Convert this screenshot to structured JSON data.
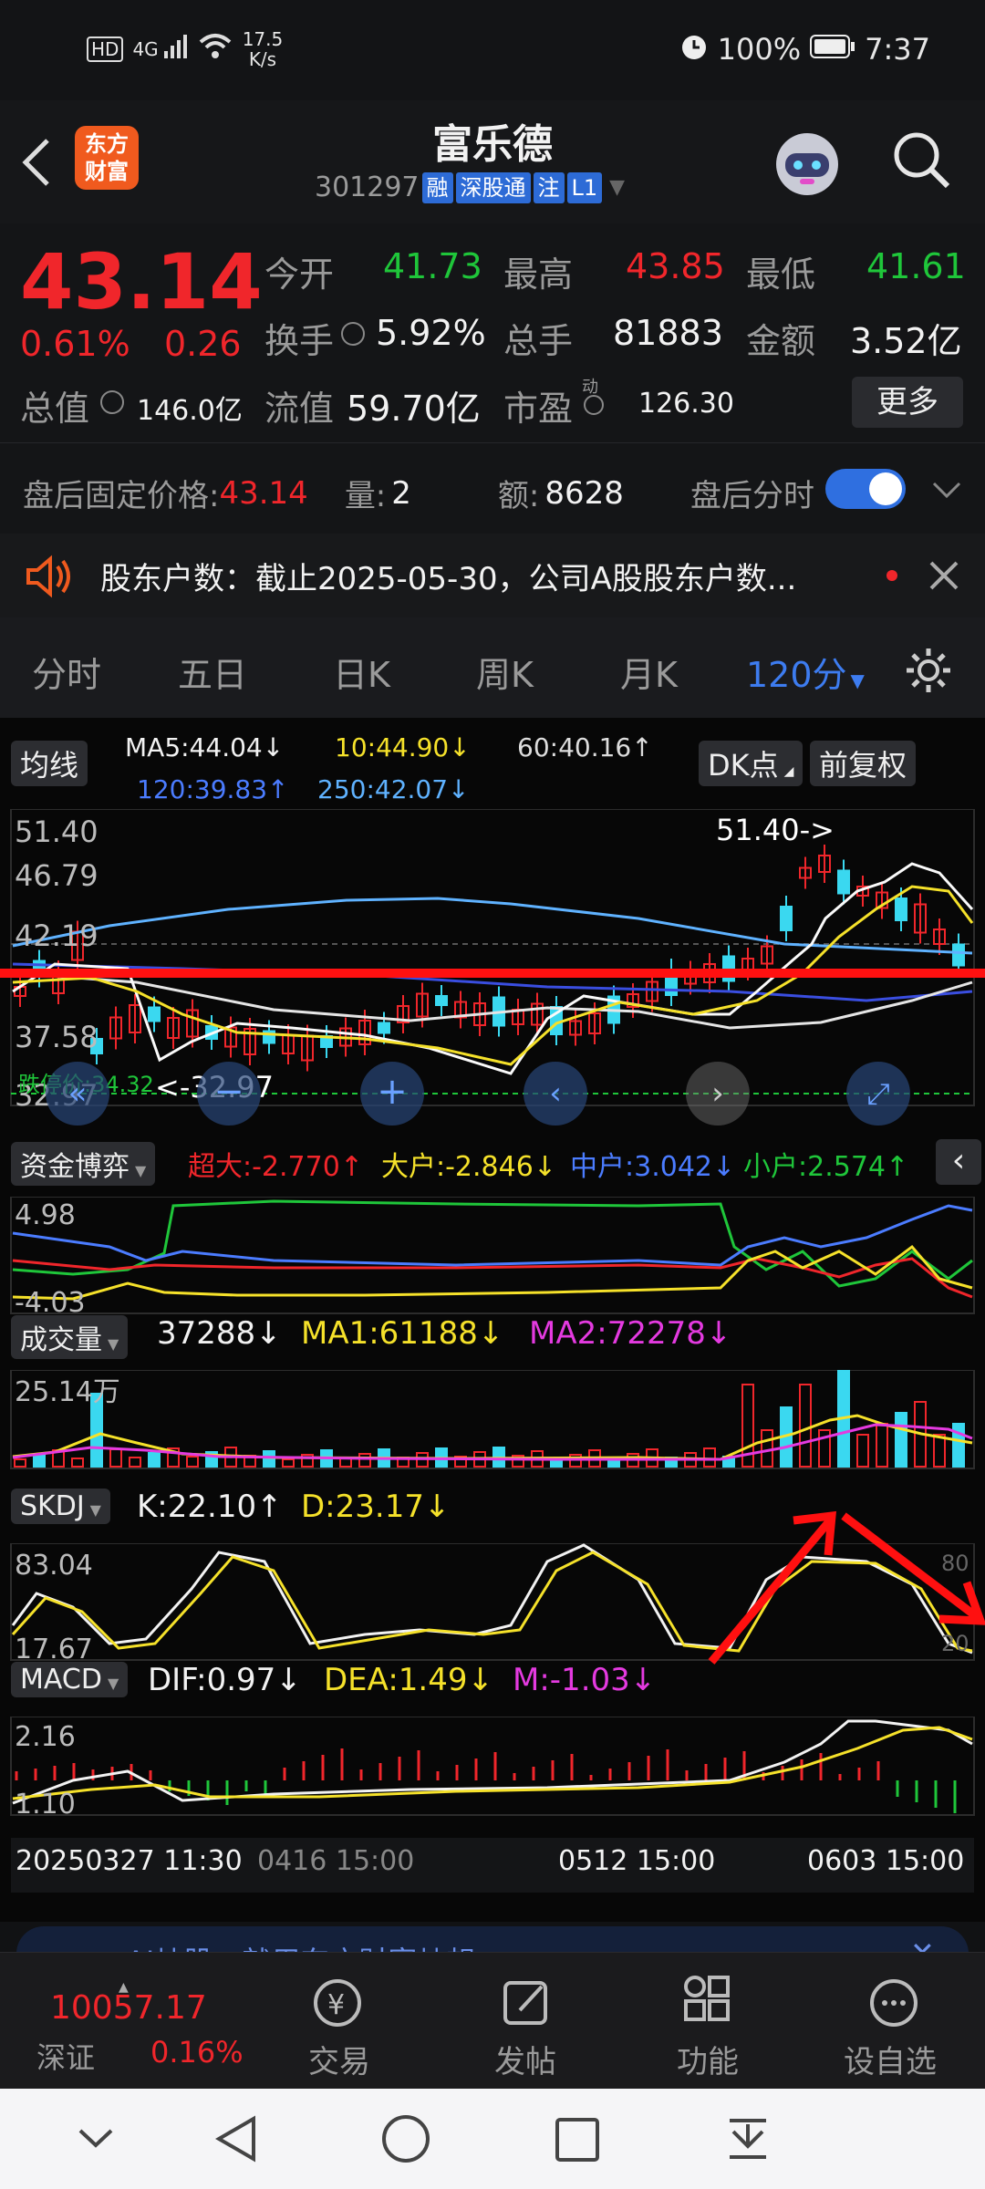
{
  "status_bar": {
    "hd": "HD",
    "net": "4G",
    "speed_value": "17.5",
    "speed_unit": "K/s",
    "battery": "100%",
    "time": "7:37"
  },
  "header": {
    "title": "富乐德",
    "code": "301297",
    "tags": [
      "融",
      "深股通",
      "注",
      "L1"
    ],
    "logo_line1": "东方",
    "logo_line2": "财富"
  },
  "quote": {
    "price": "43.14",
    "change_pct": "0.61%",
    "change": "0.26",
    "open_label": "今开",
    "open": "41.73",
    "high_label": "最高",
    "high": "43.85",
    "low_label": "最低",
    "low": "41.61",
    "turnover_label": "换手",
    "turnover": "5.92%",
    "volume_label": "总手",
    "volume": "81883",
    "amount_label": "金额",
    "amount": "3.52亿",
    "total_cap_label": "总值",
    "total_cap": "146.0亿",
    "float_cap_label": "流值",
    "float_cap": "59.70亿",
    "pe_label": "市盈",
    "pe_sup": "动",
    "pe": "126.30",
    "more": "更多"
  },
  "after_hours": {
    "label": "盘后固定价格:",
    "price": "43.14",
    "vol_label": "量:",
    "vol": "2",
    "amt_label": "额:",
    "amt": "8628",
    "toggle_label": "盘后分时"
  },
  "notice": {
    "text": "股东户数：截止2025-05-30，公司A股股东户数..."
  },
  "tabs": {
    "items": [
      "分时",
      "五日",
      "日K",
      "周K",
      "月K",
      "120分"
    ],
    "active": 5
  },
  "ma_bar": {
    "btn": "均线",
    "ma5": "MA5:44.04",
    "ma10": "10:44.90",
    "ma60": "60:40.16",
    "ma120": "120:39.83",
    "ma250": "250:42.07",
    "dk": "DK点",
    "fq": "前复权",
    "arr_down": "↓",
    "arr_up": "↑"
  },
  "main_chart": {
    "y_top": "51.40",
    "y_mid1": "46.79",
    "y_mid2": "42.19",
    "y_mid3": "37.58",
    "y_bot": "32.97",
    "max_label": "51.40->",
    "min_label": "<-32.97",
    "limit_label": "跌停价:34.32"
  },
  "fund": {
    "btn": "资金博弈",
    "super": "超大:-2.770",
    "big": "大户:-2.846",
    "mid": "中户:3.042",
    "small": "小户:2.574",
    "y_top": "4.98",
    "y_bot": "-4.03"
  },
  "vol_panel": {
    "btn": "成交量",
    "v": "37288",
    "ma1": "MA1:61188",
    "ma2": "MA2:72278",
    "y_top": "25.14万"
  },
  "skdj": {
    "btn": "SKDJ",
    "k": "K:22.10",
    "d": "D:23.17",
    "y_top": "83.04",
    "y_bot": "17.67",
    "r_top": "80",
    "r_bot": "20"
  },
  "macd": {
    "btn": "MACD",
    "dif": "DIF:0.97",
    "dea": "DEA:1.49",
    "m": "M:-1.03",
    "y_top": "2.16",
    "y_bot": "1.10"
  },
  "x_axis": {
    "l1": "20250327 11:30",
    "l2": "0416 15:00",
    "l3": "0512 15:00",
    "l4": "0603 15:00"
  },
  "ai_banner": {
    "text": "AI炒股，就用东方财富炒想"
  },
  "bottom": {
    "index_value": "10057.17",
    "index_name": "深证",
    "index_pct": "0.16%",
    "trade": "交易",
    "post": "发帖",
    "func": "功能",
    "watch": "设自选"
  },
  "colors": {
    "up": "#f0262b",
    "down": "#1fc63a",
    "accent": "#2d6bd6",
    "bg": "#070707"
  }
}
